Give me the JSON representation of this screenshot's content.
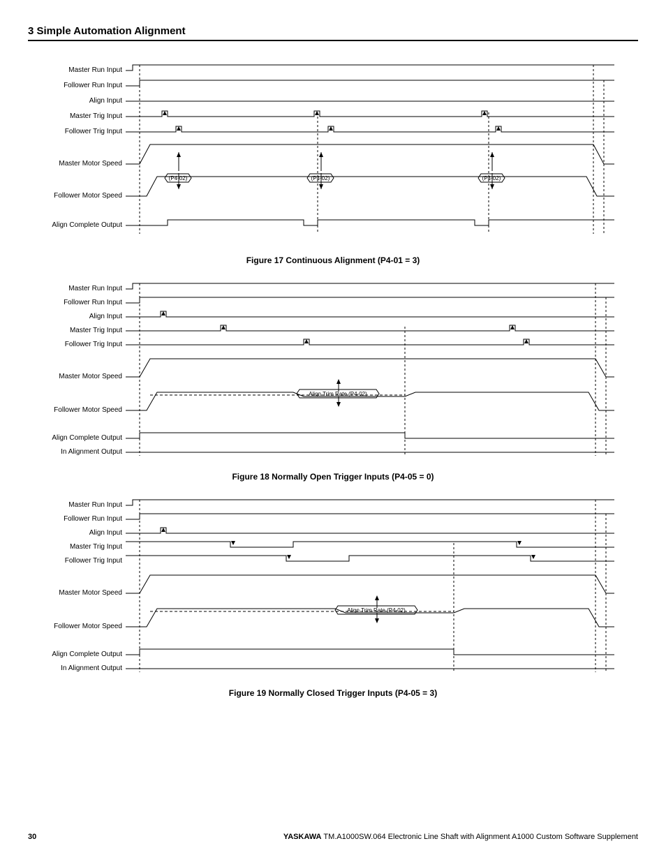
{
  "section_heading": "3  Simple Automation Alignment",
  "footer": {
    "page": "30",
    "brand": "YASKAWA",
    "doc": " TM.A1000SW.064 Electronic Line Shaft with Alignment A1000 Custom Software Supplement"
  },
  "captions": {
    "f17": "Figure 17  Continuous Alignment (P4-01 = 3)",
    "f18": "Figure 18  Normally Open Trigger Inputs (P4-05 = 0)",
    "f19": "Figure 19  Normally Closed Trigger Inputs (P4-05 = 3)"
  },
  "labels": {
    "master_run": "Master Run Input",
    "follower_run": "Follower Run Input",
    "align_input": "Align Input",
    "master_trig": "Master Trig Input",
    "follower_trig": "Follower Trig Input",
    "master_speed": "Master Motor Speed",
    "follower_speed": "Follower Motor Speed",
    "align_complete": "Align Complete Output",
    "in_alignment": "In Alignment Output",
    "p402": "(P4-02)",
    "align_trim": "Align Trim Rate (P4-02)"
  }
}
